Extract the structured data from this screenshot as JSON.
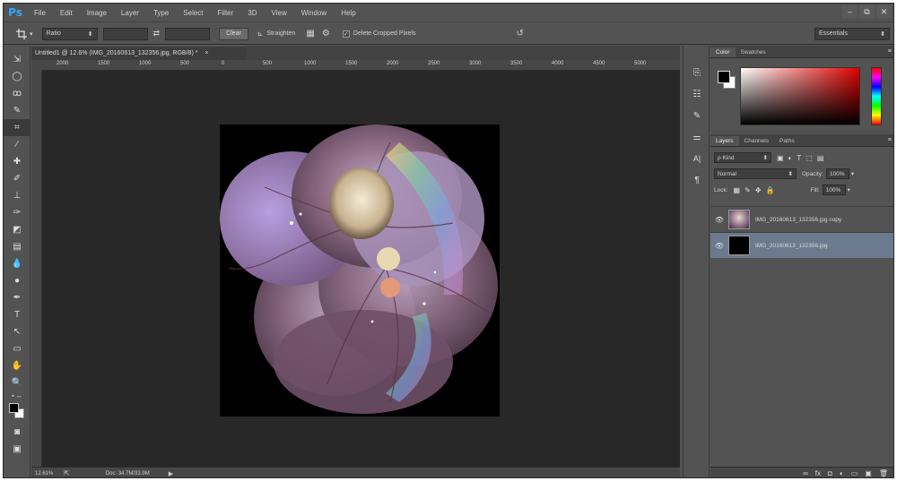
{
  "app": {
    "logo": "Ps"
  },
  "menu": [
    "File",
    "Edit",
    "Image",
    "Layer",
    "Type",
    "Select",
    "Filter",
    "3D",
    "View",
    "Window",
    "Help"
  ],
  "window_controls": [
    "–",
    "⧉",
    "✕"
  ],
  "options": {
    "ratio": "Ratio",
    "clear": "Clear",
    "straighten": "Straighten",
    "delete_cropped": "Delete Cropped Pixels",
    "workspace": "Essentials"
  },
  "document": {
    "tab_title": "Untitled1 @ 12.6% (IMG_20160613_132356.jpg, RGB/8) *",
    "close": "×",
    "ruler_labels": [
      "2000",
      "1500",
      "1000",
      "500",
      "0",
      "500",
      "1000",
      "1500",
      "2000",
      "2500",
      "3000",
      "3500",
      "4000",
      "4500",
      "5000"
    ]
  },
  "status": {
    "zoom": "12.61%",
    "doc": "Doc: 34.7M/33.9M"
  },
  "color_panel": {
    "tabs": [
      "Color",
      "Swatches"
    ],
    "menu": "≡"
  },
  "layers_panel": {
    "tabs": [
      "Layers",
      "Channels",
      "Paths"
    ],
    "kind": "ρ Kind",
    "blend_mode": "Normal",
    "opacity_label": "Opacity:",
    "opacity_value": "100%",
    "lock_label": "Lock:",
    "fill_label": "Fill:",
    "fill_value": "100%",
    "layers": [
      {
        "name": "IMG_20160613_132356.jpg copy",
        "selected": false
      },
      {
        "name": "IMG_20160613_132356.jpg",
        "selected": true
      }
    ],
    "footer_icons": [
      "∞",
      "fx",
      "◘",
      "◐",
      "▭",
      "▣",
      "🗑"
    ]
  },
  "colors": {
    "accent": "#31a8ff",
    "selected_layer": "#6b7a8f",
    "canvas_bg": "#282828"
  }
}
